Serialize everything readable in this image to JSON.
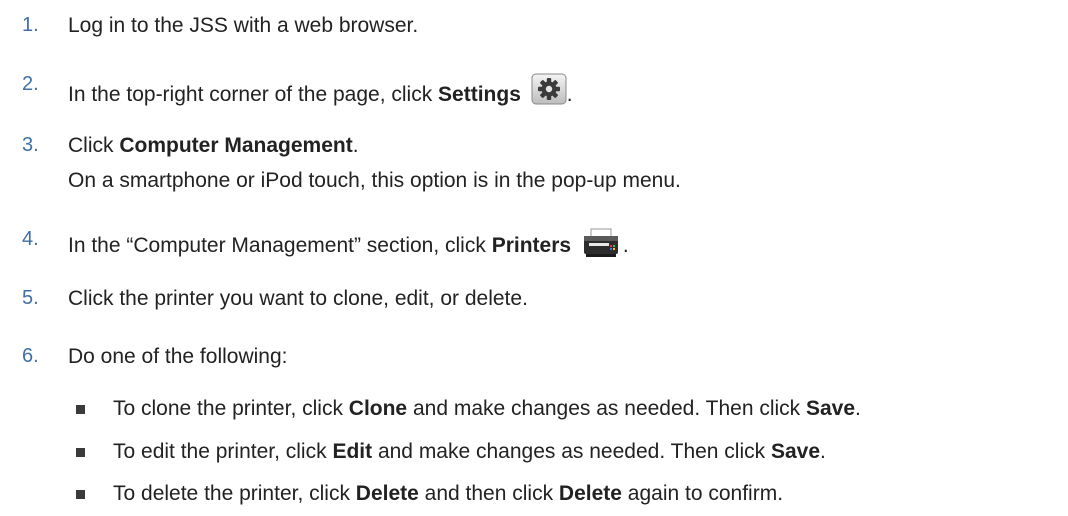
{
  "steps": [
    {
      "num": "1.",
      "text": "Log in to the JSS with a web browser."
    },
    {
      "num": "2.",
      "pre": "In the top-right corner of the page, click ",
      "bold": "Settings",
      "icon": "gear-icon",
      "post": "."
    },
    {
      "num": "3.",
      "pre": "Click ",
      "bold": "Computer Management",
      "post": ".",
      "sub": "On a smartphone or iPod touch, this option is in the pop-up menu."
    },
    {
      "num": "4.",
      "pre": "In the “Computer Management” section, click ",
      "bold": "Printers",
      "icon": "printer-icon",
      "post": "."
    },
    {
      "num": "5.",
      "text": "Click the printer you want to clone, edit, or delete."
    },
    {
      "num": "6.",
      "text": "Do one of the following:"
    }
  ],
  "bullets": [
    {
      "pre": "To clone the printer, click ",
      "bold1": "Clone",
      "mid": " and make changes as needed. Then click ",
      "bold2": "Save",
      "post": "."
    },
    {
      "pre": "To edit the printer, click ",
      "bold1": "Edit",
      "mid": " and make changes as needed. Then click ",
      "bold2": "Save",
      "post": "."
    },
    {
      "pre": "To delete the printer, click ",
      "bold1": "Delete",
      "mid": " and then click ",
      "bold2": "Delete",
      "post": " again to confirm."
    }
  ]
}
